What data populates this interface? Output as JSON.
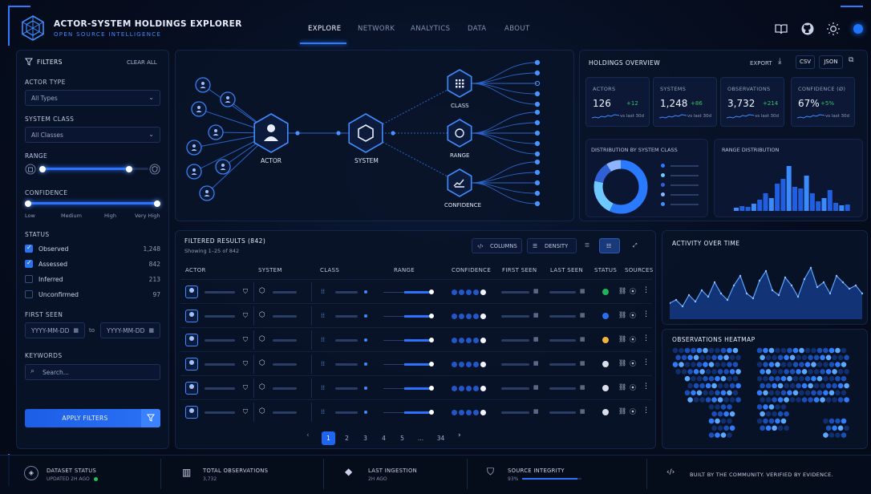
{
  "app": {
    "title": "ACTOR-SYSTEM HOLDINGS EXPLORER",
    "subtitle": "OPEN SOURCE INTELLIGENCE"
  },
  "nav": [
    "EXPLORE",
    "NETWORK",
    "ANALYTICS",
    "DATA",
    "ABOUT"
  ],
  "filters": {
    "title": "FILTERS",
    "clear": "CLEAR ALL",
    "actor_type_label": "ACTOR TYPE",
    "actor_type_value": "All Types",
    "system_class_label": "SYSTEM CLASS",
    "system_class_value": "All Classes",
    "range_label": "RANGE",
    "confidence_label": "CONFIDENCE",
    "confidence_ticks": [
      "Low",
      "Medium",
      "High",
      "Very High"
    ],
    "status_label": "STATUS",
    "status": [
      {
        "label": "Observed",
        "count": "1,248",
        "checked": true
      },
      {
        "label": "Assessed",
        "count": "842",
        "checked": true
      },
      {
        "label": "Inferred",
        "count": "213",
        "checked": false
      },
      {
        "label": "Unconfirmed",
        "count": "97",
        "checked": false
      }
    ],
    "first_seen_label": "FIRST SEEN",
    "date_placeholder": "YYYY-MM-DD",
    "date_to": "to",
    "keywords_label": "KEYWORDS",
    "search_placeholder": "Search...",
    "apply": "APPLY FILTERS"
  },
  "graph": {
    "actor": "ACTOR",
    "system": "SYSTEM",
    "class": "CLASS",
    "range": "RANGE",
    "confidence": "CONFIDENCE"
  },
  "overview": {
    "title": "HOLDINGS OVERVIEW",
    "export": "EXPORT",
    "csv": "CSV",
    "json": "JSON",
    "kpis": [
      {
        "label": "ACTORS",
        "value": "126",
        "delta": "+12",
        "cmp": "vs last 30d"
      },
      {
        "label": "SYSTEMS",
        "value": "1,248",
        "delta": "+86",
        "cmp": "vs last 30d"
      },
      {
        "label": "OBSERVATIONS",
        "value": "3,732",
        "delta": "+214",
        "cmp": "vs last 30d"
      },
      {
        "label": "CONFIDENCE (Ø)",
        "value": "67%",
        "delta": "+5%",
        "cmp": "vs last 30d"
      }
    ],
    "dist_title": "DISTRIBUTION BY SYSTEM CLASS",
    "range_title": "RANGE DISTRIBUTION"
  },
  "results": {
    "title": "FILTERED RESULTS (842)",
    "showing": "Showing 1–25 of 842",
    "columns_btn": "COLUMNS",
    "density_btn": "DENSITY",
    "headers": [
      "ACTOR",
      "SYSTEM",
      "CLASS",
      "RANGE",
      "CONFIDENCE",
      "FIRST SEEN",
      "LAST SEEN",
      "STATUS",
      "SOURCES"
    ],
    "rows": [
      {
        "status": "#1fb35a"
      },
      {
        "status": "#2a6ff0"
      },
      {
        "status": "#f0b43c"
      },
      {
        "status": "#d8deea"
      },
      {
        "status": "#d8deea"
      },
      {
        "status": "#d8deea"
      }
    ],
    "pages": [
      "1",
      "2",
      "3",
      "4",
      "5",
      "...",
      "34"
    ]
  },
  "activity": {
    "title": "ACTIVITY OVER TIME"
  },
  "heatmap": {
    "title": "OBSERVATIONS HEATMAP"
  },
  "footer": {
    "dataset_status": "DATASET STATUS",
    "dataset_updated": "UPDATED 2H AGO",
    "total_obs": "TOTAL OBSERVATIONS",
    "total_obs_value": "3,732",
    "last_ing": "LAST INGESTION",
    "last_ing_value": "2H AGO",
    "integrity": "SOURCE INTEGRITY",
    "integrity_value": "93%",
    "integrity_level": 0.93,
    "tagline": "BUILT BY THE COMMUNITY. VERIFIED BY EVIDENCE."
  }
}
